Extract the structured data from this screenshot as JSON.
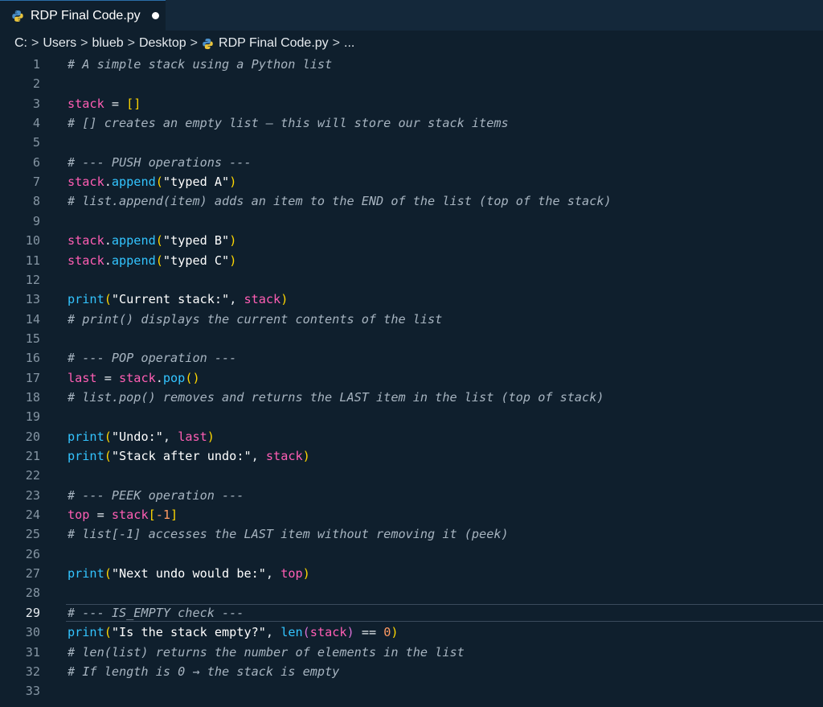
{
  "tab": {
    "title": "RDP Final Code.py",
    "icon": "python-file-icon",
    "dirty": true
  },
  "breadcrumb": {
    "items": [
      "C:",
      "Users",
      "blueb",
      "Desktop",
      "RDP Final Code.py",
      "..."
    ],
    "separator": ">"
  },
  "editor": {
    "current_line": 29,
    "lines": [
      [
        [
          "cm",
          "# A simple stack using a Python list"
        ]
      ],
      [],
      [
        [
          "var",
          "stack"
        ],
        [
          "op",
          " = "
        ],
        [
          "br",
          "[]"
        ]
      ],
      [
        [
          "cm",
          "# [] creates an empty list — this will store our stack items"
        ]
      ],
      [],
      [
        [
          "cm",
          "# --- PUSH operations ---"
        ]
      ],
      [
        [
          "var",
          "stack"
        ],
        [
          "op",
          "."
        ],
        [
          "fn",
          "append"
        ],
        [
          "br",
          "("
        ],
        [
          "str",
          "\"typed A\""
        ],
        [
          "br",
          ")"
        ]
      ],
      [
        [
          "cm",
          "# list.append(item) adds an item to the END of the list (top of the stack)"
        ]
      ],
      [],
      [
        [
          "var",
          "stack"
        ],
        [
          "op",
          "."
        ],
        [
          "fn",
          "append"
        ],
        [
          "br",
          "("
        ],
        [
          "str",
          "\"typed B\""
        ],
        [
          "br",
          ")"
        ]
      ],
      [
        [
          "var",
          "stack"
        ],
        [
          "op",
          "."
        ],
        [
          "fn",
          "append"
        ],
        [
          "br",
          "("
        ],
        [
          "str",
          "\"typed C\""
        ],
        [
          "br",
          ")"
        ]
      ],
      [],
      [
        [
          "fn",
          "print"
        ],
        [
          "br",
          "("
        ],
        [
          "str",
          "\"Current stack:\""
        ],
        [
          "op",
          ", "
        ],
        [
          "var",
          "stack"
        ],
        [
          "br",
          ")"
        ]
      ],
      [
        [
          "cm",
          "# print() displays the current contents of the list"
        ]
      ],
      [],
      [
        [
          "cm",
          "# --- POP operation ---"
        ]
      ],
      [
        [
          "var",
          "last"
        ],
        [
          "op",
          " = "
        ],
        [
          "var",
          "stack"
        ],
        [
          "op",
          "."
        ],
        [
          "fn",
          "pop"
        ],
        [
          "br",
          "()"
        ]
      ],
      [
        [
          "cm",
          "# list.pop() removes and returns the LAST item in the list (top of stack)"
        ]
      ],
      [],
      [
        [
          "fn",
          "print"
        ],
        [
          "br",
          "("
        ],
        [
          "str",
          "\"Undo:\""
        ],
        [
          "op",
          ", "
        ],
        [
          "var",
          "last"
        ],
        [
          "br",
          ")"
        ]
      ],
      [
        [
          "fn",
          "print"
        ],
        [
          "br",
          "("
        ],
        [
          "str",
          "\"Stack after undo:\""
        ],
        [
          "op",
          ", "
        ],
        [
          "var",
          "stack"
        ],
        [
          "br",
          ")"
        ]
      ],
      [],
      [
        [
          "cm",
          "# --- PEEK operation ---"
        ]
      ],
      [
        [
          "var",
          "top"
        ],
        [
          "op",
          " = "
        ],
        [
          "var",
          "stack"
        ],
        [
          "br",
          "["
        ],
        [
          "num",
          "-1"
        ],
        [
          "br",
          "]"
        ]
      ],
      [
        [
          "cm",
          "# list[-1] accesses the LAST item without removing it (peek)"
        ]
      ],
      [],
      [
        [
          "fn",
          "print"
        ],
        [
          "br",
          "("
        ],
        [
          "str",
          "\"Next undo would be:\""
        ],
        [
          "op",
          ", "
        ],
        [
          "var",
          "top"
        ],
        [
          "br",
          ")"
        ]
      ],
      [],
      [
        [
          "cm",
          "# --- IS_EMPTY check ---"
        ]
      ],
      [
        [
          "fn",
          "print"
        ],
        [
          "br",
          "("
        ],
        [
          "str",
          "\"Is the stack empty?\""
        ],
        [
          "op",
          ", "
        ],
        [
          "fn",
          "len"
        ],
        [
          "br2",
          "("
        ],
        [
          "var",
          "stack"
        ],
        [
          "br2",
          ")"
        ],
        [
          "op",
          " == "
        ],
        [
          "num",
          "0"
        ],
        [
          "br",
          ")"
        ]
      ],
      [
        [
          "cm",
          "# len(list) returns the number of elements in the list"
        ]
      ],
      [
        [
          "cm",
          "# If length is 0 → the stack is empty"
        ]
      ],
      []
    ]
  },
  "colors": {
    "background": "#0f1f2d",
    "comment": "#a7b4c0",
    "variable": "#ff5eb4",
    "function": "#33c4ff",
    "string": "#ffffff",
    "bracket": "#ffd700",
    "number": "#ff9a62"
  }
}
